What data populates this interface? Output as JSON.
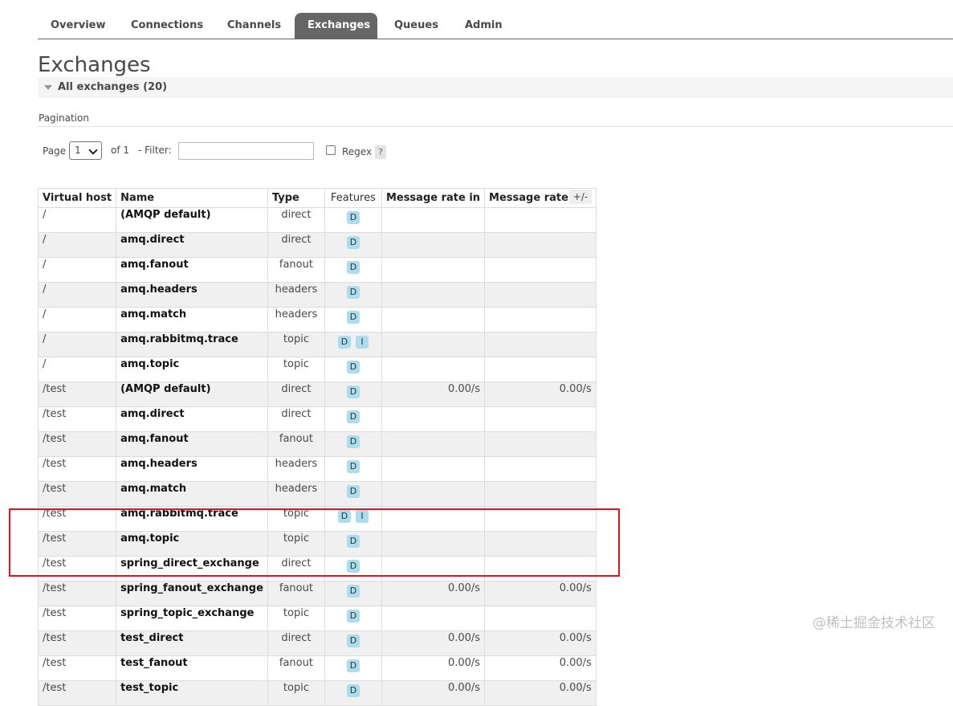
{
  "nav": {
    "tabs": [
      {
        "label": "Overview",
        "active": false
      },
      {
        "label": "Connections",
        "active": false
      },
      {
        "label": "Channels",
        "active": false
      },
      {
        "label": "Exchanges",
        "active": true
      },
      {
        "label": "Queues",
        "active": false
      },
      {
        "label": "Admin",
        "active": false
      }
    ]
  },
  "page": {
    "title": "Exchanges",
    "section_label": "All exchanges (20)"
  },
  "pagination": {
    "label": "Pagination",
    "page_label": "Page",
    "page_value": "1",
    "of_label": "of 1",
    "filter_label": "- Filter:",
    "filter_value": "",
    "regex_label": "Regex",
    "regex_checked": false,
    "help_label": "?"
  },
  "table": {
    "columns": [
      "Virtual host",
      "Name",
      "Type",
      "Features",
      "Message rate in",
      "Message rate out"
    ],
    "toggle_label": "+/-",
    "rows": [
      {
        "vhost": "/",
        "name": "(AMQP default)",
        "type": "direct",
        "features": [
          "D"
        ],
        "rate_in": "",
        "rate_out": ""
      },
      {
        "vhost": "/",
        "name": "amq.direct",
        "type": "direct",
        "features": [
          "D"
        ],
        "rate_in": "",
        "rate_out": ""
      },
      {
        "vhost": "/",
        "name": "amq.fanout",
        "type": "fanout",
        "features": [
          "D"
        ],
        "rate_in": "",
        "rate_out": ""
      },
      {
        "vhost": "/",
        "name": "amq.headers",
        "type": "headers",
        "features": [
          "D"
        ],
        "rate_in": "",
        "rate_out": ""
      },
      {
        "vhost": "/",
        "name": "amq.match",
        "type": "headers",
        "features": [
          "D"
        ],
        "rate_in": "",
        "rate_out": ""
      },
      {
        "vhost": "/",
        "name": "amq.rabbitmq.trace",
        "type": "topic",
        "features": [
          "D",
          "I"
        ],
        "rate_in": "",
        "rate_out": ""
      },
      {
        "vhost": "/",
        "name": "amq.topic",
        "type": "topic",
        "features": [
          "D"
        ],
        "rate_in": "",
        "rate_out": ""
      },
      {
        "vhost": "/test",
        "name": "(AMQP default)",
        "type": "direct",
        "features": [
          "D"
        ],
        "rate_in": "0.00/s",
        "rate_out": "0.00/s"
      },
      {
        "vhost": "/test",
        "name": "amq.direct",
        "type": "direct",
        "features": [
          "D"
        ],
        "rate_in": "",
        "rate_out": ""
      },
      {
        "vhost": "/test",
        "name": "amq.fanout",
        "type": "fanout",
        "features": [
          "D"
        ],
        "rate_in": "",
        "rate_out": ""
      },
      {
        "vhost": "/test",
        "name": "amq.headers",
        "type": "headers",
        "features": [
          "D"
        ],
        "rate_in": "",
        "rate_out": ""
      },
      {
        "vhost": "/test",
        "name": "amq.match",
        "type": "headers",
        "features": [
          "D"
        ],
        "rate_in": "",
        "rate_out": ""
      },
      {
        "vhost": "/test",
        "name": "amq.rabbitmq.trace",
        "type": "topic",
        "features": [
          "D",
          "I"
        ],
        "rate_in": "",
        "rate_out": ""
      },
      {
        "vhost": "/test",
        "name": "amq.topic",
        "type": "topic",
        "features": [
          "D"
        ],
        "rate_in": "",
        "rate_out": ""
      },
      {
        "vhost": "/test",
        "name": "spring_direct_exchange",
        "type": "direct",
        "features": [
          "D"
        ],
        "rate_in": "",
        "rate_out": ""
      },
      {
        "vhost": "/test",
        "name": "spring_fanout_exchange",
        "type": "fanout",
        "features": [
          "D"
        ],
        "rate_in": "0.00/s",
        "rate_out": "0.00/s"
      },
      {
        "vhost": "/test",
        "name": "spring_topic_exchange",
        "type": "topic",
        "features": [
          "D"
        ],
        "rate_in": "",
        "rate_out": ""
      },
      {
        "vhost": "/test",
        "name": "test_direct",
        "type": "direct",
        "features": [
          "D"
        ],
        "rate_in": "0.00/s",
        "rate_out": "0.00/s"
      },
      {
        "vhost": "/test",
        "name": "test_fanout",
        "type": "fanout",
        "features": [
          "D"
        ],
        "rate_in": "0.00/s",
        "rate_out": "0.00/s"
      },
      {
        "vhost": "/test",
        "name": "test_topic",
        "type": "topic",
        "features": [
          "D"
        ],
        "rate_in": "0.00/s",
        "rate_out": "0.00/s"
      }
    ]
  },
  "watermark": "@稀土掘金技术社区",
  "colors": {
    "active_tab": "#666666",
    "badge": "#aaddee",
    "highlight_box": "#e0141e"
  }
}
